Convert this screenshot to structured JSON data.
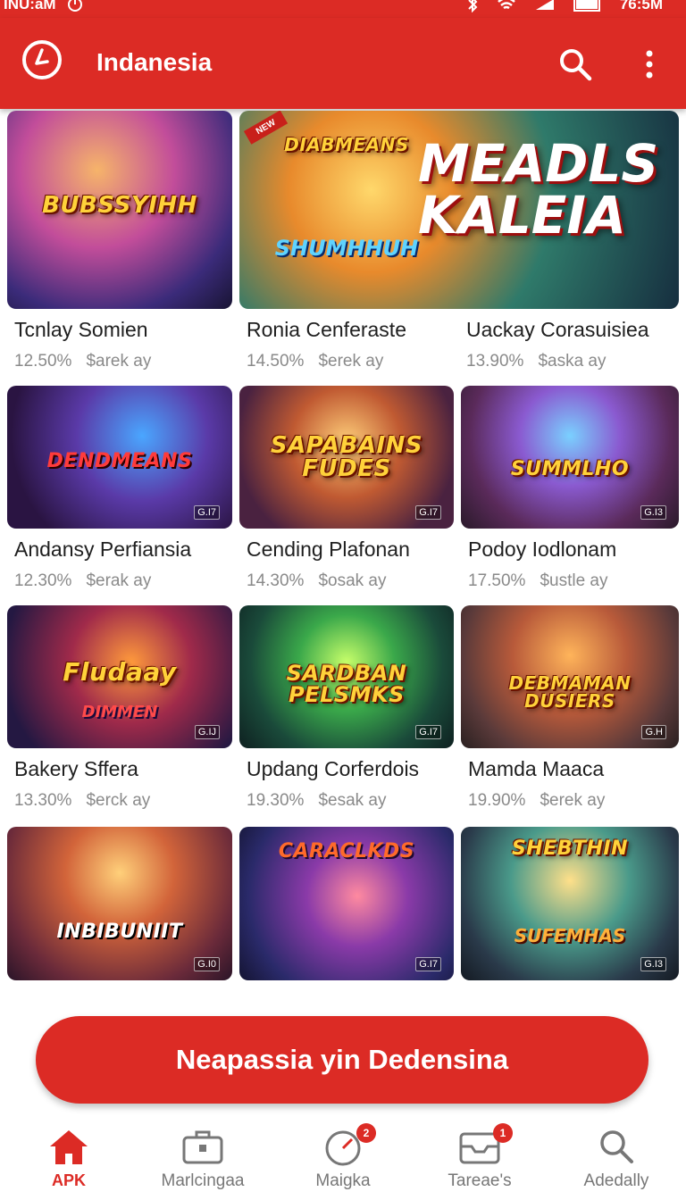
{
  "status_bar": {
    "left_text": "INU:aM",
    "time": "76:5M"
  },
  "app_bar": {
    "title": "Indanesia"
  },
  "games": [
    {
      "name": "Tcnlay Somien",
      "percent": "12.50%",
      "meta": "$arek ay",
      "art_title": "BUBSSYIHH",
      "art_sub": "",
      "badge": ""
    },
    {
      "name": "Ronia Cenferaste",
      "percent": "14.50%",
      "meta": "$erek ay",
      "art_title": "DIABMEANS",
      "art_sub": "SHUMHHUH",
      "badge": ""
    },
    {
      "name": "Uackay Corasuisiea",
      "percent": "13.90%",
      "meta": "$aska ay",
      "art_title": "MEADLS KALEIA",
      "art_sub": "",
      "badge": ""
    },
    {
      "name": "Andansy Perfiansia",
      "percent": "12.30%",
      "meta": "$erak ay",
      "art_title": "DENDMEANS",
      "art_sub": "",
      "badge": "G.I7"
    },
    {
      "name": "Cending Plafonan",
      "percent": "14.30%",
      "meta": "$osak ay",
      "art_title": "SAPABAINS FUDES",
      "art_sub": "",
      "badge": "G.I7"
    },
    {
      "name": "Podoy Iodlonam",
      "percent": "17.50%",
      "meta": "$ustle ay",
      "art_title": "SUMMLHO",
      "art_sub": "",
      "badge": "G.I3"
    },
    {
      "name": "Bakery Sffera",
      "percent": "13.30%",
      "meta": "$erck ay",
      "art_title": "Fludaay",
      "art_sub": "DIMMEN",
      "badge": "G.IJ"
    },
    {
      "name": "Updang Corferdois",
      "percent": "19.30%",
      "meta": "$esak ay",
      "art_title": "SARDBAN PELSMKS",
      "art_sub": "",
      "badge": "G.I7"
    },
    {
      "name": "Mamda Maaca",
      "percent": "19.90%",
      "meta": "$erek ay",
      "art_title": "DEBMAMAN DUSIERS",
      "art_sub": "",
      "badge": "G.H"
    },
    {
      "name": "",
      "percent": "",
      "meta": "",
      "art_title": "INBIBUNIIT",
      "art_sub": "",
      "badge": "G.I0"
    },
    {
      "name": "",
      "percent": "",
      "meta": "",
      "art_title": "CARACLKDS",
      "art_sub": "",
      "badge": "G.I7"
    },
    {
      "name": "",
      "percent": "",
      "meta": "",
      "art_title": "SHEBTHIN",
      "art_sub": "SUFEMHAS",
      "badge": "G.I3"
    }
  ],
  "cta": {
    "label": "Neapassia yin Dedensina"
  },
  "bottom_nav": [
    {
      "label": "APK",
      "icon": "home-icon",
      "active": true,
      "badge": ""
    },
    {
      "label": "Marlcingaa",
      "icon": "briefcase-icon",
      "active": false,
      "badge": ""
    },
    {
      "label": "Maigka",
      "icon": "timer-icon",
      "active": false,
      "badge": "2"
    },
    {
      "label": "Tareae's",
      "icon": "tray-icon",
      "active": false,
      "badge": "1"
    },
    {
      "label": "Adedally",
      "icon": "search-icon",
      "active": false,
      "badge": ""
    }
  ],
  "colors": {
    "primary": "#dc2b25",
    "text": "#1f1f1f",
    "meta_text": "#8a8a8a"
  }
}
